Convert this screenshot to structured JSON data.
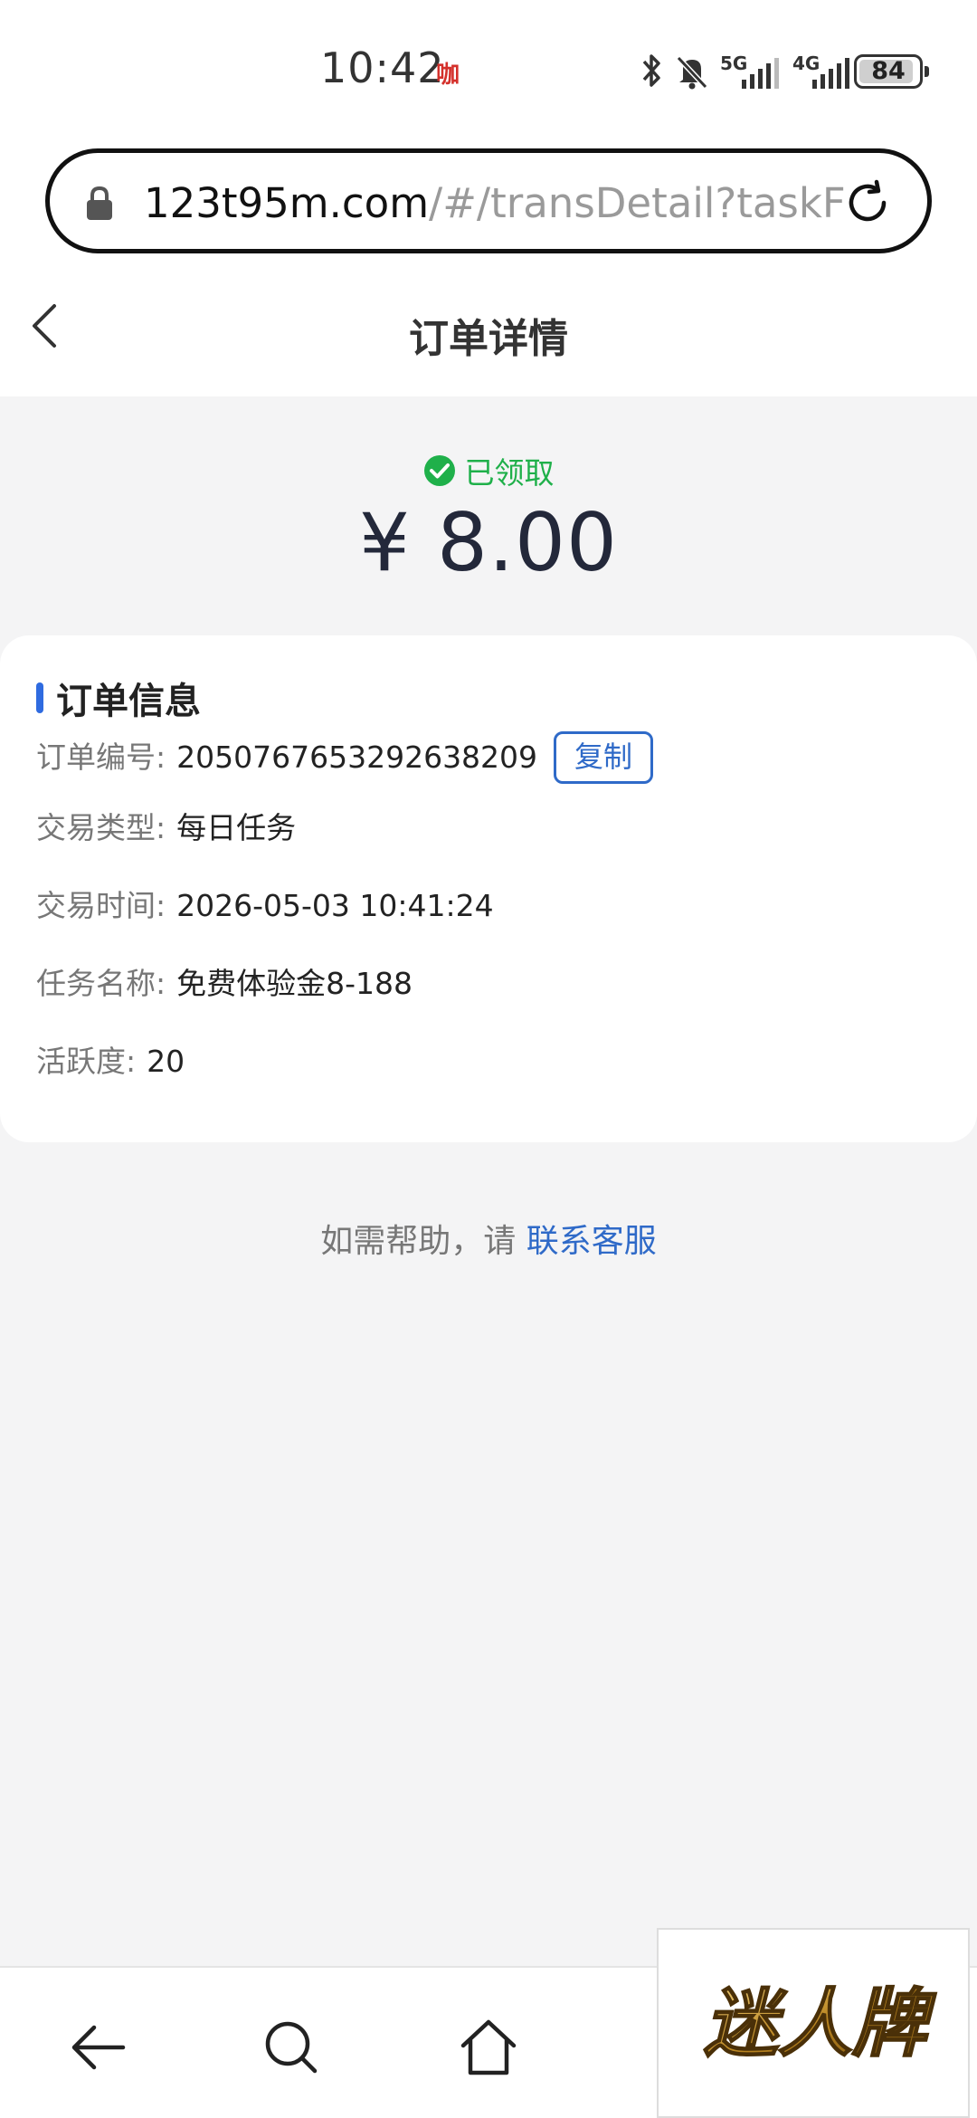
{
  "status_bar": {
    "time": "10:42",
    "app_badge": "咖",
    "network_1": "5G",
    "network_2": "4G",
    "battery_level": "84",
    "battery_fraction": 0.84
  },
  "browser": {
    "url_domain": "123t95m.com",
    "url_path": "/#/transDetail?taskF"
  },
  "header": {
    "title": "订单详情"
  },
  "summary": {
    "status": "已领取",
    "status_color": "#1fb04a",
    "amount": "¥ 8.00"
  },
  "card": {
    "title": "订单信息",
    "accent_color": "#2f6be0",
    "copy_label": "复制",
    "rows": [
      {
        "label": "订单编号:",
        "value": "2050767653292638209"
      },
      {
        "label": "交易类型:",
        "value": "每日任务"
      },
      {
        "label": "交易时间:",
        "value": "2026-05-03 10:41:24"
      },
      {
        "label": "任务名称:",
        "value": "免费体验金8-188"
      },
      {
        "label": "活跃度:",
        "value": "20"
      }
    ]
  },
  "help": {
    "prefix": "如需帮助，请 ",
    "link": "联系客服",
    "link_color": "#2f6ac8"
  },
  "bottom_nav": {
    "icons": [
      "back-arrow-icon",
      "search-icon",
      "home-icon"
    ]
  },
  "watermark": {
    "text": "迷人牌"
  }
}
